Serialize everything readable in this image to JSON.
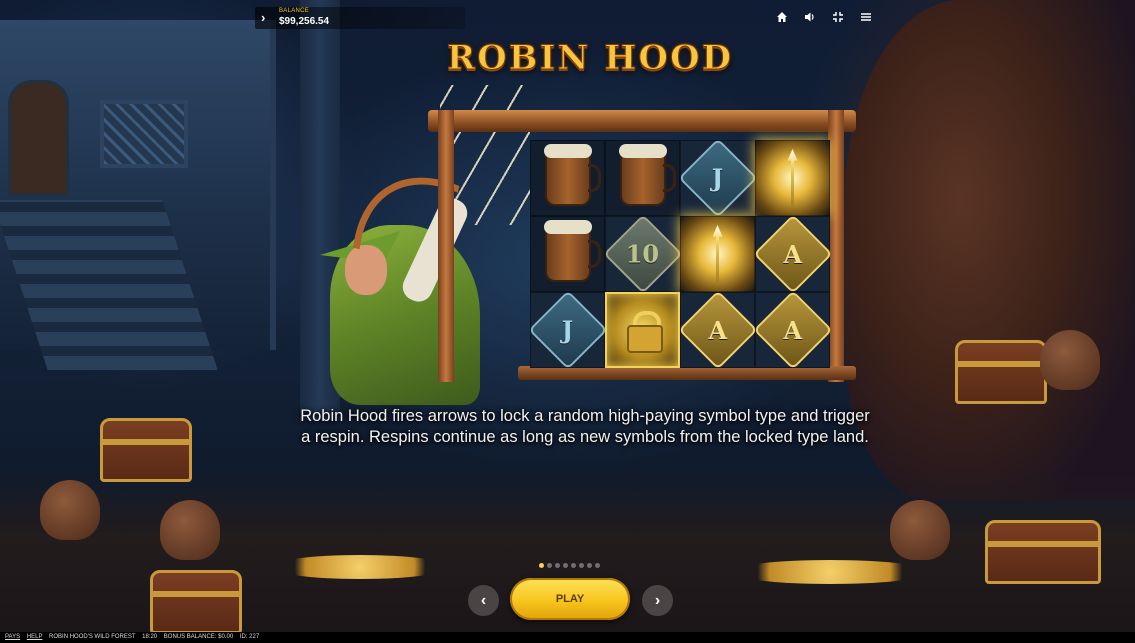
{
  "topbar": {
    "balance_label": "BALANCE",
    "balance_value": "$99,256.54",
    "icons": [
      "chevron-right-icon",
      "home-icon",
      "sound-icon",
      "fullscreen-icon",
      "menu-icon"
    ]
  },
  "title": "ROBIN HOOD",
  "reels": {
    "rows": [
      [
        "",
        "mug",
        "mug",
        "J",
        "arrow-glow"
      ],
      [
        "",
        "mug",
        "10",
        "arrow-glow",
        "A"
      ],
      [
        "",
        "J",
        "lock",
        "A",
        "A"
      ]
    ]
  },
  "description": "Robin Hood fires arrows to lock a random high-paying symbol type and trigger a respin. Respins continue as long as new symbols from the locked type land.",
  "pagination": {
    "total": 8,
    "active": 0
  },
  "buttons": {
    "prev": "‹",
    "play": "PLAY",
    "next": "›"
  },
  "footer": {
    "pays": "PAYS",
    "help": "HELP",
    "game_name": "ROBIN HOOD'S WILD FOREST",
    "time": "18:20",
    "bonus_balance": "BONUS BALANCE: $0.00",
    "id": "ID: 227"
  },
  "colors": {
    "accent_gold": "#f6c640",
    "play_button": "#f7c51d",
    "text": "#f2f2f2"
  }
}
